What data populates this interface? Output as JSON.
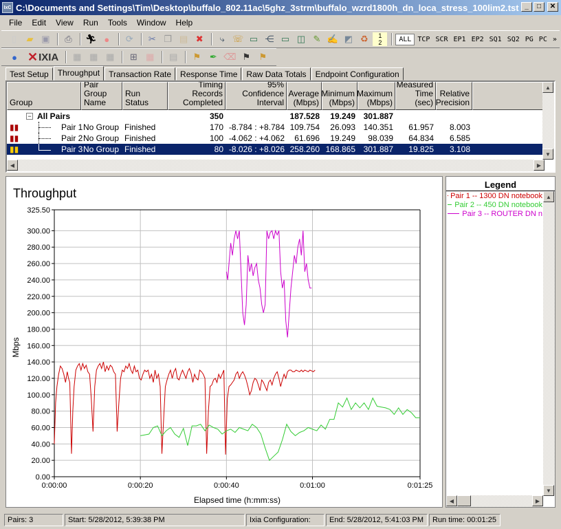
{
  "window": {
    "title": "C:\\Documents and Settings\\Tim\\Desktop\\buffalo_802.11ac\\5ghz_3strm\\buffalo_wzrd1800h_dn_loca_stress_100lim2.tst",
    "app_icon": "ixchariot-icon",
    "buttons": [
      "minimize",
      "maximize",
      "close"
    ]
  },
  "menu": [
    "File",
    "Edit",
    "View",
    "Run",
    "Tools",
    "Window",
    "Help"
  ],
  "toolbar": {
    "icons1": [
      "new-icon",
      "open-icon",
      "save-icon",
      "print-icon",
      "run-icon",
      "stop-icon",
      "refresh-icon",
      "cut-icon",
      "copy-icon",
      "paste-icon",
      "delete-icon",
      "pair-icon",
      "phone-icon",
      "tv-icon",
      "multicast-icon",
      "video-icon",
      "voip-icon",
      "edit-script-icon",
      "signature-icon",
      "hardware-icon",
      "renew-icon",
      "sort-icon"
    ],
    "filters": [
      "ALL",
      "TCP",
      "SCR",
      "EP1",
      "EP2",
      "SQ1",
      "SQ2",
      "PG",
      "PC"
    ],
    "active_filter": "ALL",
    "more": "»",
    "icons2": [
      "info-icon",
      "chart-icon-1",
      "chart-icon-2",
      "chart-icon-3",
      "network-icon",
      "chart-icon-4",
      "clipboard-icon",
      "flag-folder-icon",
      "pin-icon",
      "eraser-icon",
      "flag-network-icon",
      "flag-phone-icon"
    ],
    "brand": "IXIA"
  },
  "tabs": [
    "Test Setup",
    "Throughput",
    "Transaction Rate",
    "Response Time",
    "Raw Data Totals",
    "Endpoint Configuration"
  ],
  "active_tab": "Throughput",
  "table": {
    "columns": [
      "Group",
      "Pair Group Name",
      "Run Status",
      "Timing Records Completed",
      "95% Confidence Interval",
      "Average (Mbps)",
      "Minimum (Mbps)",
      "Maximum (Mbps)",
      "Measured Time (sec)",
      "Relative Precision"
    ],
    "summary": {
      "group": "All Pairs",
      "records": "350",
      "average": "187.528",
      "minimum": "19.249",
      "maximum": "301.887"
    },
    "rows": [
      {
        "pair": "Pair 1",
        "group_name": "No Group",
        "status": "Finished",
        "records": "170",
        "ci": "-8.784 : +8.784",
        "average": "109.754",
        "minimum": "26.093",
        "maximum": "140.351",
        "time": "61.957",
        "precision": "8.003",
        "selected": false
      },
      {
        "pair": "Pair 2",
        "group_name": "No Group",
        "status": "Finished",
        "records": "100",
        "ci": "-4.062 : +4.062",
        "average": "61.696",
        "minimum": "19.249",
        "maximum": "98.039",
        "time": "64.834",
        "precision": "6.585",
        "selected": false
      },
      {
        "pair": "Pair 3",
        "group_name": "No Group",
        "status": "Finished",
        "records": "80",
        "ci": "-8.026 : +8.026",
        "average": "258.260",
        "minimum": "168.865",
        "maximum": "301.887",
        "time": "19.825",
        "precision": "3.108",
        "selected": true
      }
    ]
  },
  "legend": {
    "title": "Legend",
    "items": [
      {
        "label": "Pair 1 -- 1300 DN notebook",
        "color": "#cc0000"
      },
      {
        "label": "Pair 2 -- 450 DN notebook",
        "color": "#33cc33"
      },
      {
        "label": "Pair 3 -- ROUTER DN n",
        "color": "#cc00cc"
      }
    ]
  },
  "chart_data": {
    "type": "line",
    "title": "Throughput",
    "xlabel": "Elapsed time (h:mm:ss)",
    "ylabel": "Mbps",
    "xlim": [
      0,
      85
    ],
    "ylim": [
      0,
      325.5
    ],
    "x_ticks": [
      {
        "v": 0,
        "label": "0:00:00"
      },
      {
        "v": 20,
        "label": "0:00:20"
      },
      {
        "v": 40,
        "label": "0:00:40"
      },
      {
        "v": 60,
        "label": "0:01:00"
      },
      {
        "v": 85,
        "label": "0:01:25"
      }
    ],
    "y_ticks": [
      {
        "v": 0,
        "label": "0.00"
      },
      {
        "v": 20,
        "label": "20.00"
      },
      {
        "v": 40,
        "label": "40.00"
      },
      {
        "v": 60,
        "label": "60.00"
      },
      {
        "v": 80,
        "label": "80.00"
      },
      {
        "v": 100,
        "label": "100.00"
      },
      {
        "v": 120,
        "label": "120.00"
      },
      {
        "v": 140,
        "label": "140.00"
      },
      {
        "v": 160,
        "label": "160.00"
      },
      {
        "v": 180,
        "label": "180.00"
      },
      {
        "v": 200,
        "label": "200.00"
      },
      {
        "v": 220,
        "label": "220.00"
      },
      {
        "v": 240,
        "label": "240.00"
      },
      {
        "v": 260,
        "label": "260.00"
      },
      {
        "v": 280,
        "label": "280.00"
      },
      {
        "v": 300,
        "label": "300.00"
      },
      {
        "v": 325.5,
        "label": "325.50"
      }
    ],
    "grid": true,
    "series": [
      {
        "name": "Pair 1 -- 1300 DN notebook",
        "color": "#cc0000",
        "x": [
          0,
          0.3,
          0.6,
          1,
          1.4,
          1.8,
          2.2,
          2.6,
          3,
          3.3,
          3.6,
          4,
          4.3,
          4.6,
          5,
          5.4,
          5.8,
          6.2,
          6.6,
          7,
          7.4,
          7.8,
          8.2,
          8.6,
          9,
          9.4,
          9.8,
          10.2,
          10.6,
          11,
          11.4,
          11.8,
          12.2,
          12.6,
          13,
          13.4,
          13.8,
          14.2,
          14.6,
          15,
          15.4,
          15.8,
          16.2,
          16.6,
          17,
          17.4,
          17.8,
          18.2,
          18.6,
          19,
          19.4,
          19.8,
          20.2,
          20.6,
          21,
          21.4,
          21.8,
          22.2,
          22.6,
          23,
          23.4,
          23.8,
          24.2,
          24.6,
          25,
          25.4,
          25.8,
          26.2,
          26.6,
          27,
          27.4,
          27.8,
          28.2,
          28.6,
          29,
          29.4,
          29.8,
          30.2,
          30.6,
          31,
          31.4,
          31.8,
          32.2,
          32.6,
          33,
          33.4,
          33.8,
          34.2,
          34.6,
          35,
          35.4,
          35.8,
          36.2,
          36.6,
          37,
          37.4,
          37.8,
          38.2,
          38.6,
          39,
          39.4,
          39.8,
          40.2,
          40.6,
          41,
          41.4,
          41.8,
          42.2,
          42.6,
          43,
          43.4,
          43.8,
          44.2,
          44.6,
          45,
          45.4,
          45.8,
          46.2,
          46.6,
          47,
          47.4,
          47.8,
          48.2,
          48.6,
          49,
          49.4,
          49.8,
          50.2,
          50.6,
          51,
          51.4,
          51.8,
          52.2,
          52.6,
          53,
          53.4,
          53.8,
          54.2,
          54.6,
          55,
          55.4,
          55.8,
          56.2,
          56.6,
          57,
          57.4,
          57.8,
          58.2,
          58.6,
          59,
          59.4,
          59.8,
          60.2,
          60.6,
          61,
          61.4,
          61.8,
          62.2
        ],
        "values": [
          40,
          90,
          110,
          125,
          135,
          132,
          125,
          115,
          128,
          120,
          115,
          28,
          80,
          110,
          130,
          135,
          138,
          130,
          138,
          132,
          136,
          128,
          125,
          95,
          55,
          110,
          130,
          135,
          138,
          132,
          140,
          128,
          135,
          130,
          136,
          134,
          128,
          125,
          55,
          90,
          120,
          130,
          128,
          135,
          132,
          138,
          130,
          126,
          135,
          128,
          130,
          120,
          118,
          125,
          130,
          128,
          130,
          120,
          125,
          115,
          130,
          120,
          125,
          110,
          28,
          70,
          110,
          118,
          125,
          130,
          120,
          128,
          132,
          120,
          118,
          125,
          130,
          125,
          120,
          128,
          132,
          126,
          115,
          125,
          120,
          118,
          130,
          128,
          125,
          120,
          28,
          80,
          110,
          112,
          118,
          120,
          115,
          125,
          120,
          125,
          130,
          27,
          95,
          110,
          112,
          115,
          118,
          125,
          128,
          120,
          125,
          128,
          124,
          118,
          110,
          100,
          105,
          115,
          120,
          118,
          112,
          105,
          118,
          115,
          110,
          105,
          115,
          118,
          112,
          120,
          125,
          128,
          120,
          110,
          118,
          125,
          120,
          128,
          130,
          130,
          128,
          128,
          130,
          129,
          128,
          130,
          128,
          130,
          129,
          128,
          130,
          129,
          128,
          130
        ]
      },
      {
        "name": "Pair 2 -- 450 DN notebook",
        "color": "#33cc33",
        "x": [
          20,
          21,
          22,
          23,
          24,
          25,
          26,
          27,
          28,
          29,
          30,
          31,
          32,
          33,
          34,
          35,
          36,
          37,
          38,
          39,
          40,
          41,
          42,
          43,
          44,
          45,
          46,
          47,
          48,
          49,
          50,
          51,
          52,
          53,
          54,
          55,
          56,
          57,
          58,
          59,
          60,
          61,
          62,
          63,
          64,
          65,
          66,
          67,
          68,
          69,
          70,
          71,
          72,
          73,
          74,
          75,
          76,
          77,
          78,
          79,
          80,
          81,
          82,
          83,
          84,
          85
        ],
        "values": [
          50,
          51,
          52,
          60,
          62,
          50,
          56,
          60,
          52,
          48,
          59,
          38,
          62,
          62,
          64,
          56,
          63,
          60,
          58,
          52,
          56,
          58,
          54,
          60,
          58,
          56,
          64,
          60,
          52,
          35,
          20,
          25,
          30,
          45,
          64,
          55,
          50,
          54,
          56,
          60,
          58,
          56,
          63,
          58,
          70,
          70,
          90,
          85,
          96,
          82,
          90,
          84,
          90,
          82,
          96,
          86,
          85,
          84,
          82,
          76,
          84,
          76,
          82,
          78,
          72,
          72
        ]
      },
      {
        "name": "Pair 3 -- ROUTER DN n",
        "color": "#cc00cc",
        "x": [
          40,
          40.3,
          40.6,
          41,
          41.4,
          41.8,
          42.2,
          42.6,
          43,
          43.4,
          43.8,
          44.2,
          44.6,
          45,
          45.4,
          45.8,
          46.2,
          46.6,
          47,
          47.4,
          47.8,
          48.2,
          48.6,
          49,
          49.4,
          49.8,
          50.2,
          50.6,
          51,
          51.4,
          51.8,
          52.2,
          52.6,
          53,
          53.4,
          53.8,
          54.2,
          54.6,
          55,
          55.4,
          55.8,
          56.2,
          56.6,
          57,
          57.4,
          57.8,
          58.2,
          58.6,
          59,
          59.4,
          59.8
        ],
        "values": [
          250,
          240,
          260,
          285,
          270,
          290,
          300,
          290,
          300,
          250,
          200,
          185,
          210,
          270,
          250,
          260,
          245,
          255,
          260,
          240,
          230,
          210,
          200,
          210,
          300,
          290,
          298,
          300,
          290,
          300,
          295,
          300,
          250,
          230,
          240,
          190,
          170,
          200,
          230,
          250,
          270,
          260,
          280,
          290,
          270,
          300,
          250,
          260,
          240,
          230,
          230
        ]
      }
    ]
  },
  "status": {
    "pairs": "Pairs: 3",
    "start": "Start: 5/28/2012, 5:39:38 PM",
    "config": "Ixia Configuration:",
    "end": "End: 5/28/2012, 5:41:03 PM",
    "runtime": "Run time: 00:01:25"
  }
}
